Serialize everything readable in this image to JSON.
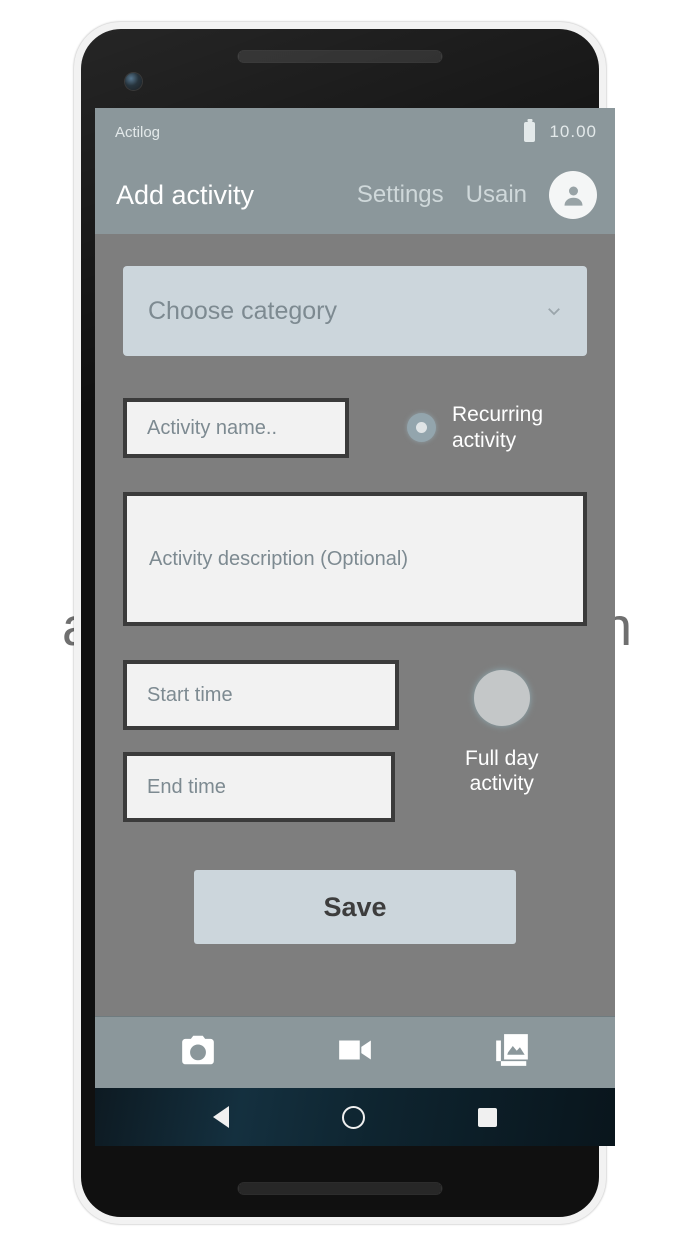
{
  "background_text": {
    "left_fragment": "a",
    "right_fragment": "n"
  },
  "device": {
    "front_camera_icon": "front-camera-icon",
    "earpiece_icon": "speaker-grille-icon",
    "power_button": "power-button",
    "volume_button": "volume-rocker-button"
  },
  "status_bar": {
    "app_name": "Actilog",
    "battery_icon": "battery-icon",
    "time": "10.00"
  },
  "app_bar": {
    "title": "Add activity",
    "settings_label": "Settings",
    "user_label": "Usain",
    "avatar_icon": "user-avatar-icon"
  },
  "form": {
    "category": {
      "placeholder": "Choose category",
      "chevron_icon": "chevron-down-icon"
    },
    "activity_name": {
      "placeholder": "Activity name.."
    },
    "recurring": {
      "label": "Recurring\nactivity",
      "label_line1": "Recurring",
      "label_line2": "activity",
      "icon": "radio-button-icon",
      "checked": true
    },
    "description": {
      "placeholder": "Activity description (Optional)"
    },
    "start_time": {
      "placeholder": "Start time"
    },
    "end_time": {
      "placeholder": "End time"
    },
    "full_day": {
      "label_line1": "Full day",
      "label_line2": "activity",
      "icon": "toggle-circle-icon",
      "checked": false
    },
    "save_label": "Save"
  },
  "media_bar": {
    "items": [
      {
        "name": "camera-icon"
      },
      {
        "name": "video-camera-icon"
      },
      {
        "name": "gallery-icon"
      }
    ]
  },
  "nav_bar": {
    "back_icon": "back-triangle-icon",
    "home_icon": "home-circle-icon",
    "recents_icon": "recents-square-icon"
  },
  "colors": {
    "app_bar": "#8b979b",
    "content_bg": "#7e7e7e",
    "accent_field": "#ccd6dc",
    "field_bg": "#f2f2f2",
    "field_border": "#3b3b3b",
    "power_button": "#e8835f"
  }
}
